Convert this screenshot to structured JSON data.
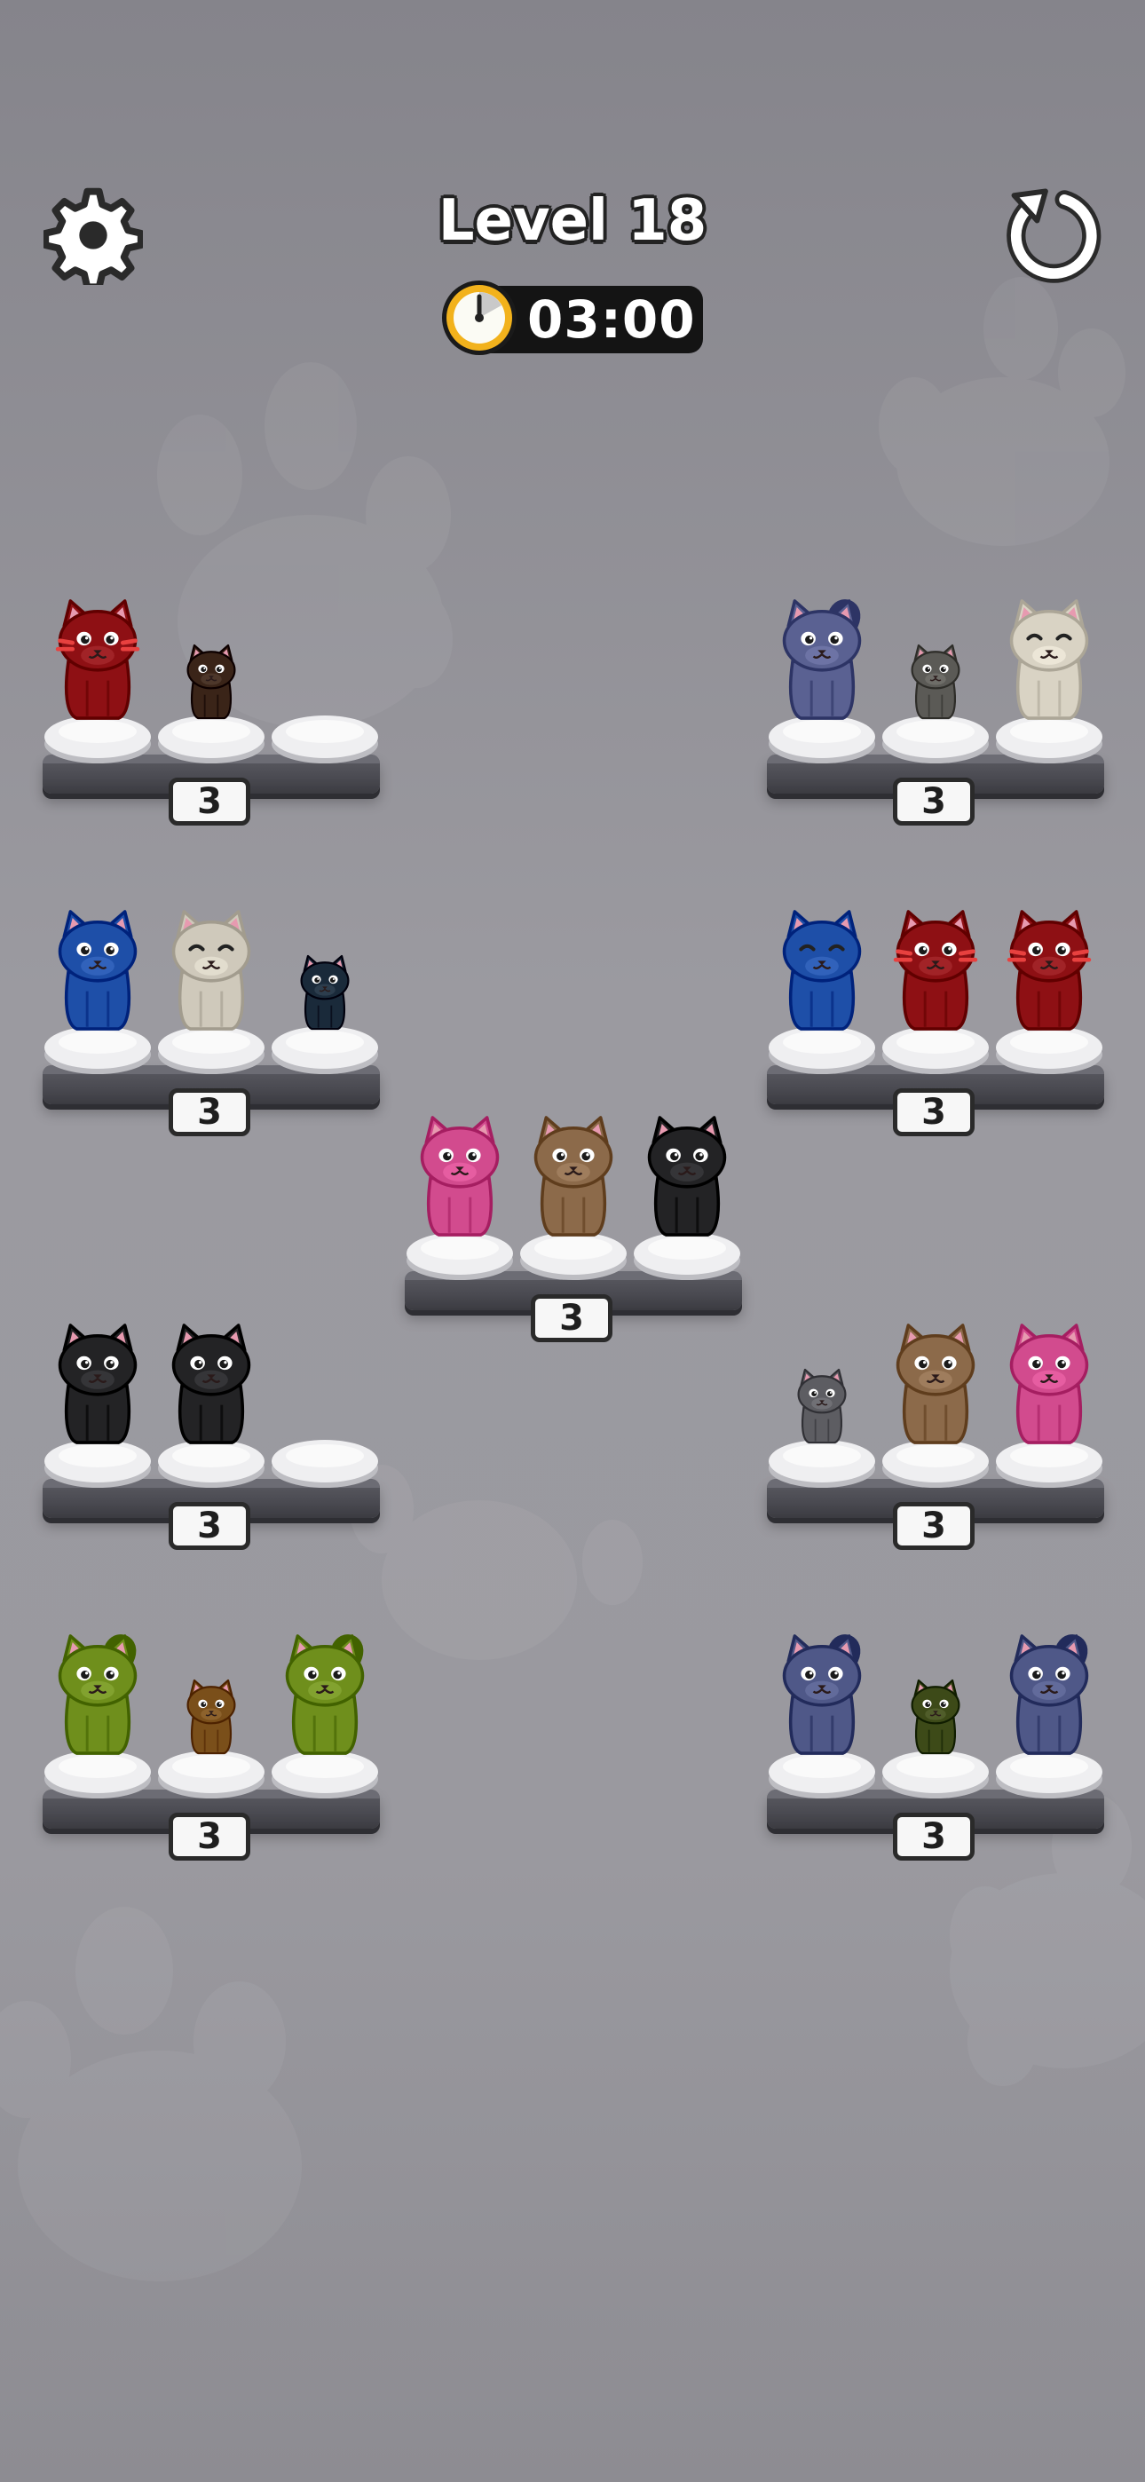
{
  "header": {
    "level_label": "Level 18",
    "timer": "03:00"
  },
  "icons": {
    "settings": "gear-icon",
    "restart": "restart-icon",
    "timer": "clock-icon"
  },
  "colors": {
    "background": "#98979d",
    "shelf": "#4a4a51",
    "cushion": "#efeff1",
    "timer_pill": "#141414",
    "clock_ring": "#f2b21c"
  },
  "shelves": [
    {
      "id": "left-1",
      "capacity": "3",
      "slots": [
        {
          "color": "#8e1014",
          "size": "big",
          "pose": "stripes"
        },
        {
          "color": "#3a2418",
          "size": "small",
          "pose": "plain"
        },
        null
      ]
    },
    {
      "id": "right-1",
      "capacity": "3",
      "slots": [
        {
          "color": "#5a6192",
          "size": "big",
          "pose": "tail"
        },
        {
          "color": "#5b5a56",
          "size": "small",
          "pose": "plain"
        },
        {
          "color": "#d9d3c4",
          "size": "big",
          "pose": "happy"
        }
      ]
    },
    {
      "id": "left-2",
      "capacity": "3",
      "slots": [
        {
          "color": "#1e4fa8",
          "size": "big",
          "pose": "plain"
        },
        {
          "color": "#cfc9bb",
          "size": "big",
          "pose": "happy"
        },
        {
          "color": "#1a2a3a",
          "size": "small",
          "pose": "plain"
        }
      ]
    },
    {
      "id": "right-2",
      "capacity": "3",
      "slots": [
        {
          "color": "#1e4fa8",
          "size": "big",
          "pose": "happy"
        },
        {
          "color": "#8e1014",
          "size": "big",
          "pose": "stripes"
        },
        {
          "color": "#8e1014",
          "size": "big",
          "pose": "stripes"
        }
      ]
    },
    {
      "id": "center",
      "capacity": "3",
      "slots": [
        {
          "color": "#d24b8e",
          "size": "big",
          "pose": "plain"
        },
        {
          "color": "#8c6a4a",
          "size": "big",
          "pose": "plain"
        },
        {
          "color": "#232325",
          "size": "big",
          "pose": "plain"
        }
      ]
    },
    {
      "id": "left-3",
      "capacity": "3",
      "slots": [
        {
          "color": "#232325",
          "size": "big",
          "pose": "plain"
        },
        {
          "color": "#232325",
          "size": "big",
          "pose": "plain"
        },
        null
      ]
    },
    {
      "id": "right-3",
      "capacity": "3",
      "slots": [
        {
          "color": "#5d5d62",
          "size": "small",
          "pose": "plain"
        },
        {
          "color": "#8c6a4a",
          "size": "big",
          "pose": "plain"
        },
        {
          "color": "#d24b8e",
          "size": "big",
          "pose": "plain"
        }
      ]
    },
    {
      "id": "left-4",
      "capacity": "3",
      "slots": [
        {
          "color": "#6f8f1c",
          "size": "big",
          "pose": "tail"
        },
        {
          "color": "#7a4f1a",
          "size": "small",
          "pose": "plain"
        },
        {
          "color": "#6f8f1c",
          "size": "big",
          "pose": "tail"
        }
      ]
    },
    {
      "id": "right-4",
      "capacity": "3",
      "slots": [
        {
          "color": "#4f5888",
          "size": "big",
          "pose": "tail"
        },
        {
          "color": "#3d4a18",
          "size": "small",
          "pose": "plain"
        },
        {
          "color": "#4f5888",
          "size": "big",
          "pose": "tail"
        }
      ]
    }
  ]
}
